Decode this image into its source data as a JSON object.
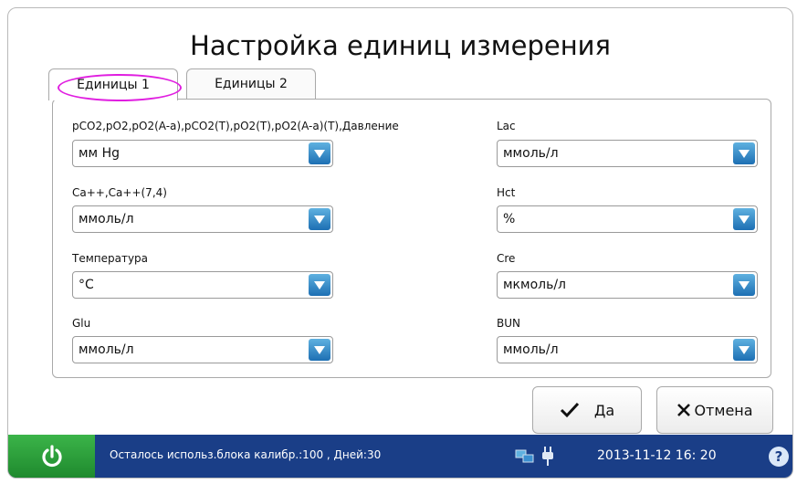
{
  "title": "Настройка единиц измерения",
  "tabs": [
    {
      "label": "Единицы 1",
      "active": true
    },
    {
      "label": "Единицы 2",
      "active": false
    }
  ],
  "fields": {
    "left": [
      {
        "label": "pCO2,pO2,pO2(A-a),pCO2(T),pO2(T),pO2(A-a)(T),Давление",
        "value": "мм Hg"
      },
      {
        "label": "Ca++,Ca++(7,4)",
        "value": "ммоль/л"
      },
      {
        "label": "Температура",
        "value": "°C"
      },
      {
        "label": "Glu",
        "value": "ммоль/л"
      }
    ],
    "right": [
      {
        "label": "Lac",
        "value": "ммоль/л"
      },
      {
        "label": "Hct",
        "value": "%"
      },
      {
        "label": "Cre",
        "value": "мкмоль/л"
      },
      {
        "label": "BUN",
        "value": "ммоль/л"
      }
    ]
  },
  "buttons": {
    "ok": "Да",
    "cancel": "Отмена"
  },
  "status": {
    "message": "Осталось использ.блока калибр.:100 , Дней:30",
    "datetime": "2013-11-12  16: 20",
    "help": "?"
  },
  "colors": {
    "accent": "#1d6fb3",
    "statusbar": "#1a3e87",
    "power": "#2ea23c",
    "highlight": "#e01ee0"
  },
  "icons": [
    "power-icon",
    "dropdown-arrow-icon",
    "check-icon",
    "close-x-icon",
    "network-icon",
    "plug-icon",
    "help-icon"
  ]
}
